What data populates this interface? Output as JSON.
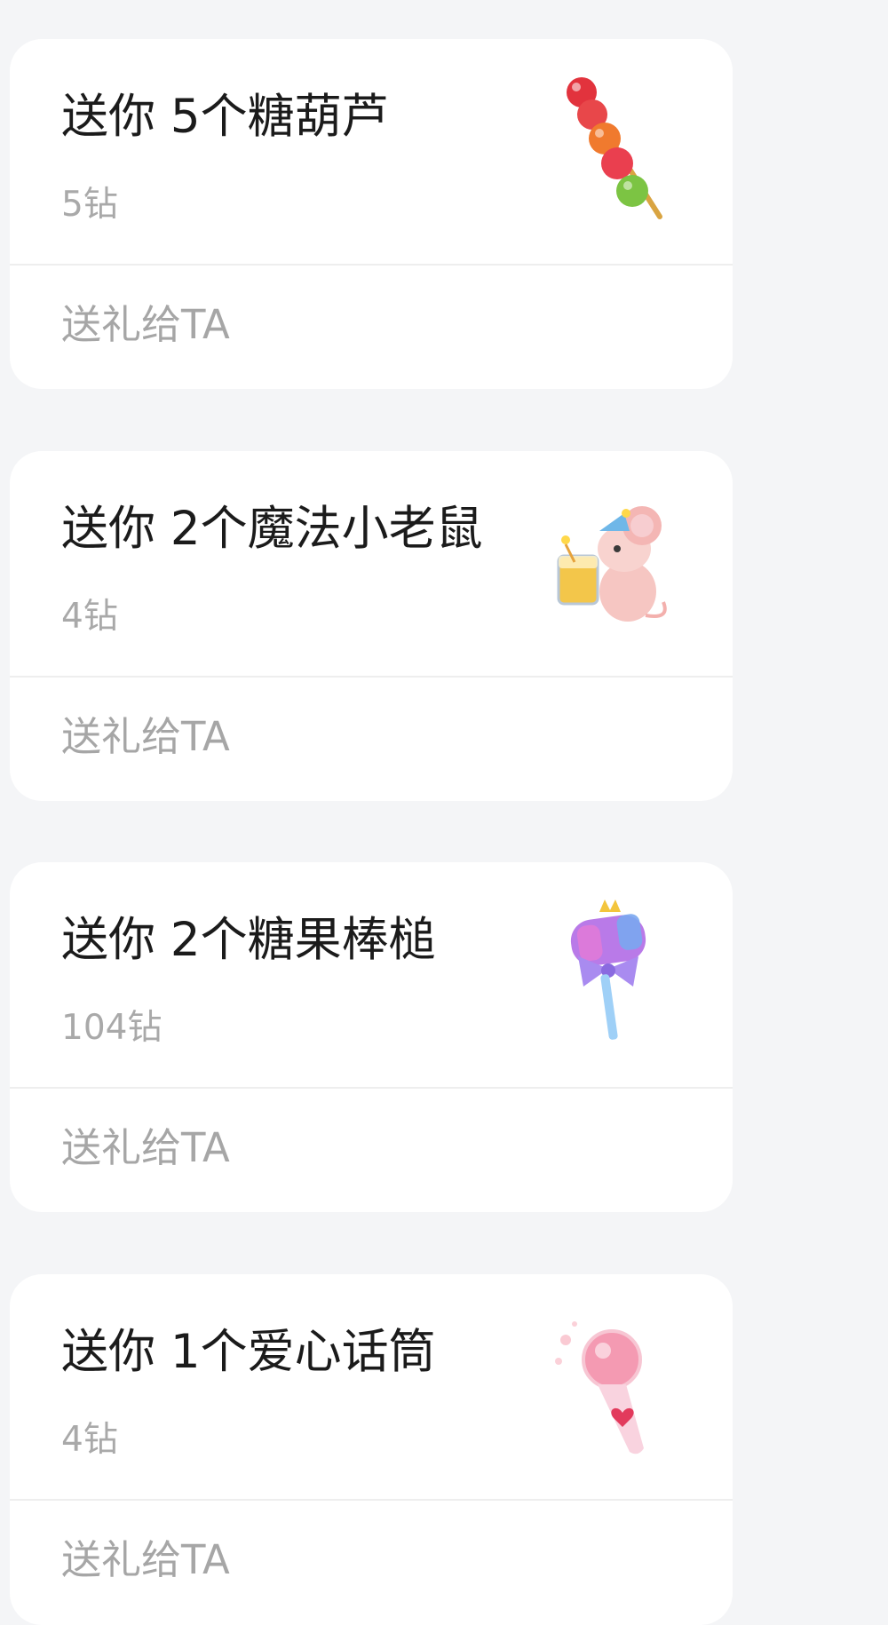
{
  "gifts": [
    {
      "title": "送你 5个糖葫芦",
      "price": "5钻",
      "action_label": "送礼给TA",
      "image_icon": "candied-haws-icon"
    },
    {
      "title": "送你 2个魔法小老鼠",
      "price": "4钻",
      "action_label": "送礼给TA",
      "image_icon": "magic-mouse-icon"
    },
    {
      "title": "送你 2个糖果棒槌",
      "price": "104钻",
      "action_label": "送礼给TA",
      "image_icon": "candy-wand-icon"
    },
    {
      "title": "送你 1个爱心话筒",
      "price": "4钻",
      "action_label": "送礼给TA",
      "image_icon": "heart-microphone-icon"
    }
  ]
}
